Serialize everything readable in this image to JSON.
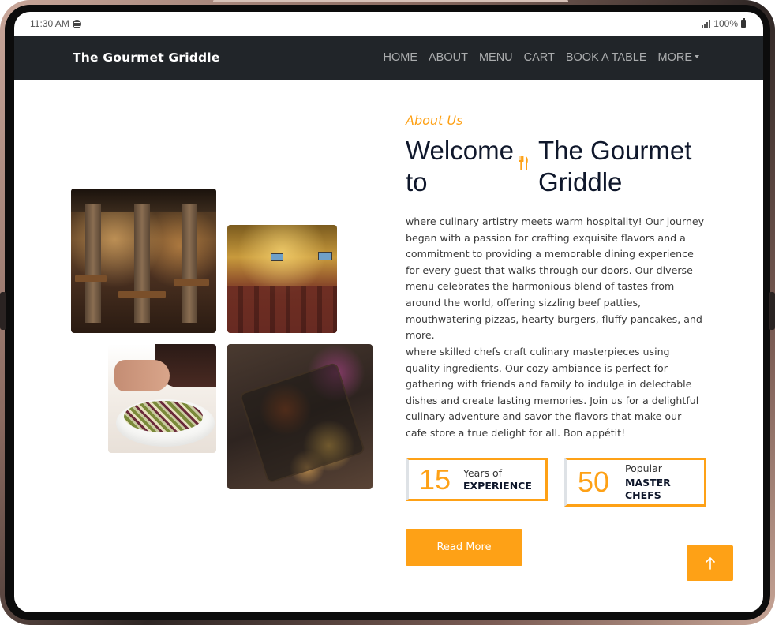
{
  "status_bar": {
    "time": "11:30 AM",
    "battery": "100%"
  },
  "navbar": {
    "brand": "The Gourmet Griddle",
    "links": [
      "HOME",
      "ABOUT",
      "MENU",
      "CART",
      "BOOK A TABLE",
      "MORE"
    ]
  },
  "about": {
    "tag": "About Us",
    "heading_part1": "Welcome to",
    "heading_part2": "The Gourmet Griddle",
    "paragraph1": "where culinary artistry meets warm hospitality! Our journey began with a passion for crafting exquisite flavors and a commitment to providing a memorable dining experience for every guest that walks through our doors. Our diverse menu celebrates the harmonious blend of tastes from around the world, offering sizzling beef patties, mouthwatering pizzas, hearty burgers, fluffy pancakes, and more.",
    "paragraph2": "where skilled chefs craft culinary masterpieces using quality ingredients. Our cozy ambiance is perfect for gathering with friends and family to indulge in delectable dishes and create lasting memories. Join us for a delightful culinary adventure and savor the flavors that make our cafe store a true delight for all. Bon appétit!",
    "stats": [
      {
        "number": "15",
        "small": "Years of",
        "big": "EXPERIENCE"
      },
      {
        "number": "50",
        "small": "Popular",
        "big": "MASTER CHEFS"
      }
    ],
    "read_more": "Read More"
  },
  "icons": {
    "utensils": "utensils-icon",
    "back_to_top": "arrow-up-icon",
    "signal": "signal-icon",
    "battery": "battery-icon",
    "spotify": "spotify-icon"
  },
  "colors": {
    "accent": "#fea116",
    "navbar": "#212529",
    "heading": "#0f172b"
  }
}
